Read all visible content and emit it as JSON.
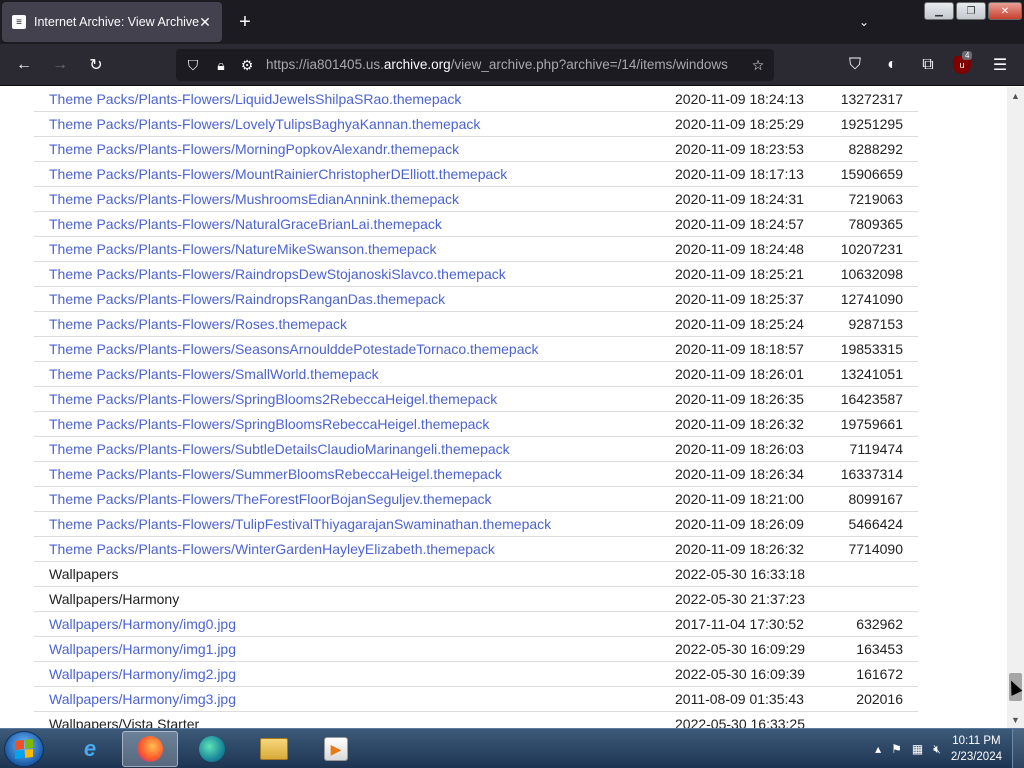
{
  "browser": {
    "tab_title": "Internet Archive: View Archive",
    "tab_favicon_glyph": "≡",
    "url_prefix": "https://ia801405.us.",
    "url_host": "archive.org",
    "url_rest": "/view_archive.php?archive=/14/items/windows",
    "extension_badge": "4"
  },
  "listing": {
    "rows": [
      {
        "name": "Theme Packs/Plants-Flowers/LiquidJewelsShilpaSRao.themepack",
        "date": "2020-11-09 18:24:13",
        "size": "13272317",
        "link": true
      },
      {
        "name": "Theme Packs/Plants-Flowers/LovelyTulipsBaghyaKannan.themepack",
        "date": "2020-11-09 18:25:29",
        "size": "19251295",
        "link": true
      },
      {
        "name": "Theme Packs/Plants-Flowers/MorningPopkovAlexandr.themepack",
        "date": "2020-11-09 18:23:53",
        "size": "8288292",
        "link": true
      },
      {
        "name": "Theme Packs/Plants-Flowers/MountRainierChristopherDElliott.themepack",
        "date": "2020-11-09 18:17:13",
        "size": "15906659",
        "link": true
      },
      {
        "name": "Theme Packs/Plants-Flowers/MushroomsEdianAnnink.themepack",
        "date": "2020-11-09 18:24:31",
        "size": "7219063",
        "link": true
      },
      {
        "name": "Theme Packs/Plants-Flowers/NaturalGraceBrianLai.themepack",
        "date": "2020-11-09 18:24:57",
        "size": "7809365",
        "link": true
      },
      {
        "name": "Theme Packs/Plants-Flowers/NatureMikeSwanson.themepack",
        "date": "2020-11-09 18:24:48",
        "size": "10207231",
        "link": true
      },
      {
        "name": "Theme Packs/Plants-Flowers/RaindropsDewStojanoskiSlavco.themepack",
        "date": "2020-11-09 18:25:21",
        "size": "10632098",
        "link": true
      },
      {
        "name": "Theme Packs/Plants-Flowers/RaindropsRanganDas.themepack",
        "date": "2020-11-09 18:25:37",
        "size": "12741090",
        "link": true
      },
      {
        "name": "Theme Packs/Plants-Flowers/Roses.themepack",
        "date": "2020-11-09 18:25:24",
        "size": "9287153",
        "link": true
      },
      {
        "name": "Theme Packs/Plants-Flowers/SeasonsArnoulddePotestadeTornaco.themepack",
        "date": "2020-11-09 18:18:57",
        "size": "19853315",
        "link": true
      },
      {
        "name": "Theme Packs/Plants-Flowers/SmallWorld.themepack",
        "date": "2020-11-09 18:26:01",
        "size": "13241051",
        "link": true
      },
      {
        "name": "Theme Packs/Plants-Flowers/SpringBlooms2RebeccaHeigel.themepack",
        "date": "2020-11-09 18:26:35",
        "size": "16423587",
        "link": true
      },
      {
        "name": "Theme Packs/Plants-Flowers/SpringBloomsRebeccaHeigel.themepack",
        "date": "2020-11-09 18:26:32",
        "size": "19759661",
        "link": true
      },
      {
        "name": "Theme Packs/Plants-Flowers/SubtleDetailsClaudioMarinangeli.themepack",
        "date": "2020-11-09 18:26:03",
        "size": "7119474",
        "link": true
      },
      {
        "name": "Theme Packs/Plants-Flowers/SummerBloomsRebeccaHeigel.themepack",
        "date": "2020-11-09 18:26:34",
        "size": "16337314",
        "link": true
      },
      {
        "name": "Theme Packs/Plants-Flowers/TheForestFloorBojanSeguljev.themepack",
        "date": "2020-11-09 18:21:00",
        "size": "8099167",
        "link": true
      },
      {
        "name": "Theme Packs/Plants-Flowers/TulipFestivalThiyagarajanSwaminathan.themepack",
        "date": "2020-11-09 18:26:09",
        "size": "5466424",
        "link": true
      },
      {
        "name": "Theme Packs/Plants-Flowers/WinterGardenHayleyElizabeth.themepack",
        "date": "2020-11-09 18:26:32",
        "size": "7714090",
        "link": true
      },
      {
        "name": "Wallpapers",
        "date": "2022-05-30 16:33:18",
        "size": "",
        "link": false
      },
      {
        "name": "Wallpapers/Harmony",
        "date": "2022-05-30 21:37:23",
        "size": "",
        "link": false
      },
      {
        "name": "Wallpapers/Harmony/img0.jpg",
        "date": "2017-11-04 17:30:52",
        "size": "632962",
        "link": true
      },
      {
        "name": "Wallpapers/Harmony/img1.jpg",
        "date": "2022-05-30 16:09:29",
        "size": "163453",
        "link": true
      },
      {
        "name": "Wallpapers/Harmony/img2.jpg",
        "date": "2022-05-30 16:09:39",
        "size": "161672",
        "link": true
      },
      {
        "name": "Wallpapers/Harmony/img3.jpg",
        "date": "2011-08-09 01:35:43",
        "size": "202016",
        "link": true
      },
      {
        "name": "Wallpapers/Vista Starter",
        "date": "2022-05-30 16:33:25",
        "size": "",
        "link": false
      }
    ]
  },
  "taskbar": {
    "time": "10:11 PM",
    "date": "2/23/2024"
  },
  "colors": {
    "link": "#4c63d2",
    "tab_bar": "#1c1b22",
    "nav_bar": "#2b2a33"
  }
}
